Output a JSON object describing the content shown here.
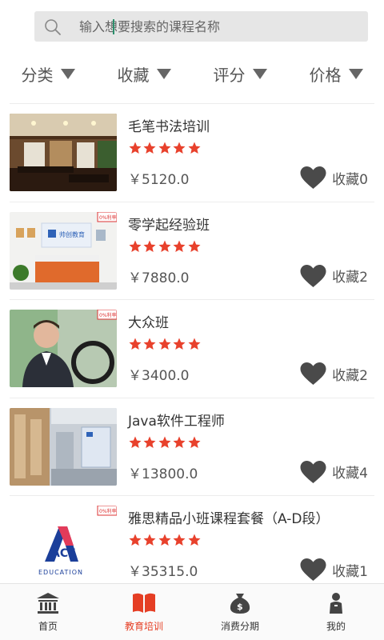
{
  "search": {
    "placeholder": "输入想要搜索的课程名称"
  },
  "filters": [
    {
      "label": "分类"
    },
    {
      "label": "收藏"
    },
    {
      "label": "评分"
    },
    {
      "label": "价格"
    }
  ],
  "courses": [
    {
      "title": "毛笔书法培训",
      "price": "￥5120.0",
      "favorites": "收藏0",
      "rating": 5
    },
    {
      "title": "零学起经验班",
      "price": "￥7880.0",
      "favorites": "收藏2",
      "rating": 5,
      "badge": "0%利率",
      "banner_text": "帅创教育"
    },
    {
      "title": "大众班",
      "price": "￥3400.0",
      "favorites": "收藏2",
      "rating": 5,
      "badge": "0%利率"
    },
    {
      "title": "Java软件工程师",
      "price": "￥13800.0",
      "favorites": "收藏4",
      "rating": 5
    },
    {
      "title": "雅思精品小班课程套餐（A-D段）",
      "price": "￥35315.0",
      "favorites": "收藏1",
      "rating": 5,
      "badge": "0%利率",
      "logo_text": "ACE",
      "logo_sub": "EDUCATION"
    }
  ],
  "tabbar": [
    {
      "label": "首页",
      "icon": "bank-icon"
    },
    {
      "label": "教育培训",
      "icon": "book-icon",
      "active": true
    },
    {
      "label": "消费分期",
      "icon": "money-bag-icon"
    },
    {
      "label": "我的",
      "icon": "person-icon"
    }
  ],
  "colors": {
    "accent": "#e53e24",
    "star": "#e8412c",
    "heart": "#4a4a4a",
    "text": "#333333"
  }
}
